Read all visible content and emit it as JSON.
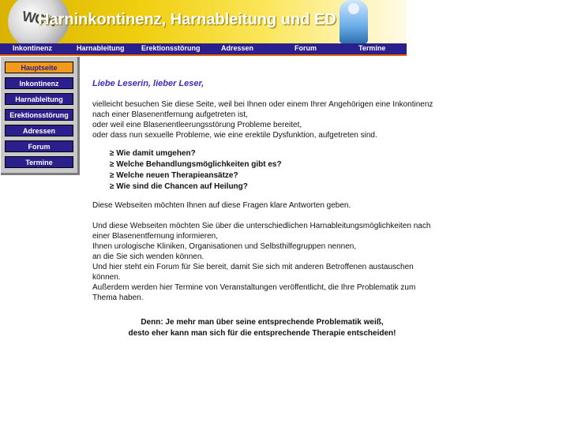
{
  "banner": {
    "title": "Harninkontinenz, Harnableitung  und ED",
    "logo_text": "WCW"
  },
  "topnav": {
    "items": [
      "Inkontinenz",
      "Harnableitung",
      "Erektionsstörung",
      "Adressen",
      "Forum",
      "Termine"
    ]
  },
  "sidebar": {
    "items": [
      "Hauptseite",
      "Inkontinenz",
      "Harnableitung",
      "Erektionsstörung",
      "Adressen",
      "Forum",
      "Termine"
    ],
    "active": "Hauptseite"
  },
  "content": {
    "greeting": "Liebe Leserin, lieber Leser,",
    "intro": [
      "vielleicht besuchen Sie diese Seite, weil bei Ihnen oder einem Ihrer Angehörigen eine Inkontinenz",
      "nach einer Blasenentfernung aufgetreten ist,",
      "oder weil eine Blasenentleerungsstörung Probleme bereitet,",
      "oder dass nun sexuelle Probleme, wie eine erektile Dysfunktion, aufgetreten sind."
    ],
    "question_marker": "≥",
    "questions": [
      "Wie damit umgehen?",
      "Welche Behandlungsmöglichkeiten gibt es?",
      "Welche neuen Therapieansätze?",
      "Wie sind die Chancen auf Heilung?"
    ],
    "answer_line": "Diese Webseiten möchten Ihnen auf diese Fragen klare Antworten geben.",
    "body": [
      "Und diese Webseiten möchten Sie über die unterschiedlichen Harnableitungsmöglichkeiten nach",
      "einer Blasenentfernung informieren,",
      "Ihnen urologische Kliniken, Organisationen und Selbsthilfegruppen nennen,",
      "an die Sie sich wenden können.",
      "Und hier steht ein Forum für Sie bereit, damit Sie sich mit anderen Betroffenen austauschen",
      "können.",
      "Außerdem werden hier Termine von Veranstaltungen veröffentlicht, die Ihre Problematik zum",
      "Thema haben."
    ],
    "conclusion": [
      "Denn: Je mehr man über seine entsprechende Problematik weiß,",
      "desto eher kann man sich für die entsprechende Therapie entscheiden!"
    ]
  }
}
